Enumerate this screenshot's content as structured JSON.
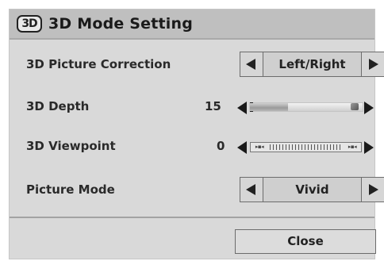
{
  "dialog": {
    "title_icon": "3D",
    "title": "3D Mode Setting"
  },
  "rows": {
    "picture_correction": {
      "label": "3D Picture Correction",
      "value": "Left/Right"
    },
    "depth": {
      "label": "3D Depth",
      "value": "15"
    },
    "viewpoint": {
      "label": "3D Viewpoint",
      "value": "0"
    },
    "picture_mode": {
      "label": "Picture Mode",
      "value": "Vivid"
    }
  },
  "footer": {
    "close_label": "Close"
  }
}
